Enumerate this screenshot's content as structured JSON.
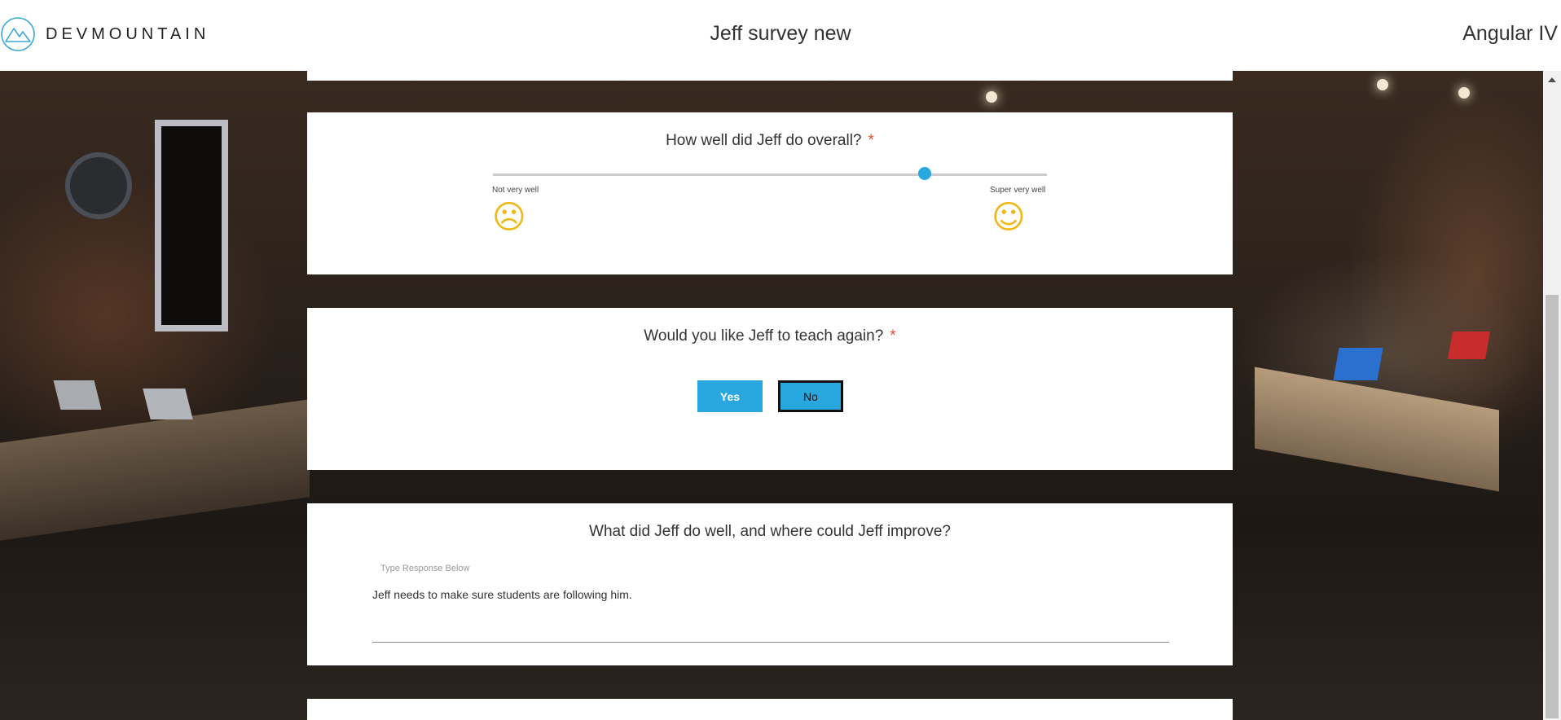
{
  "header": {
    "logo_text": "DEVMOUNTAIN",
    "survey_title": "Jeff survey new",
    "course_name": "Angular IV"
  },
  "questions": [
    {
      "prompt": "How well did Jeff do overall?",
      "required_mark": "*",
      "type": "slider",
      "slider_value_fraction": 0.78,
      "min_label": "Not very well",
      "max_label": "Super very well",
      "min_icon": "frowning-face-thumbs-down-icon",
      "max_icon": "winking-face-thumbs-up-icon"
    },
    {
      "prompt": "Would you like Jeff to teach again?",
      "required_mark": "*",
      "type": "yes-no",
      "yes_label": "Yes",
      "no_label": "No",
      "selected": "No"
    },
    {
      "prompt": "What did Jeff do well, and where could Jeff improve?",
      "type": "text",
      "placeholder": "Type Response Below",
      "value": "Jeff needs to make sure students are following him."
    }
  ],
  "colors": {
    "accent": "#29a8e0",
    "required": "#e2512f",
    "card_background": "#ffffff"
  }
}
